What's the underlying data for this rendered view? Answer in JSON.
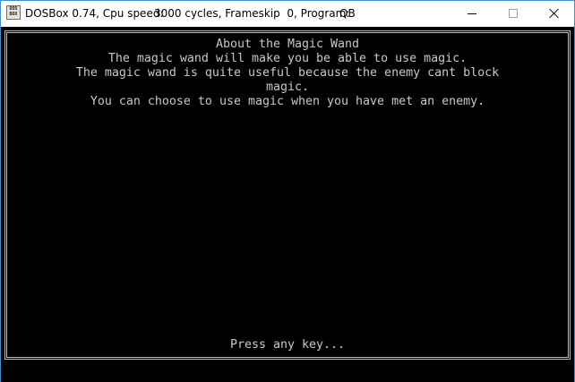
{
  "window": {
    "app_name": "DOSBox 0.74, Cpu speed:",
    "cycles": "3000 cycles, Frameskip  0, Program:",
    "program": "QB",
    "icon_text": "DOS BOX"
  },
  "screen": {
    "heading": "About the Magic Wand",
    "lines": [
      "The magic wand will make you be able to use magic.",
      "The magic wand is quite useful because the enemy cant block",
      "magic.",
      "You can choose to use magic when you have met an enemy."
    ],
    "prompt": "Press any key..."
  },
  "colors": {
    "screen_background": "#000000",
    "text": "#c8c8c8",
    "frame": "#bdbdbd",
    "window_border": "#3a8fd6"
  },
  "icons": [
    "dosbox-app-icon",
    "minimize-icon",
    "maximize-icon",
    "close-icon"
  ]
}
